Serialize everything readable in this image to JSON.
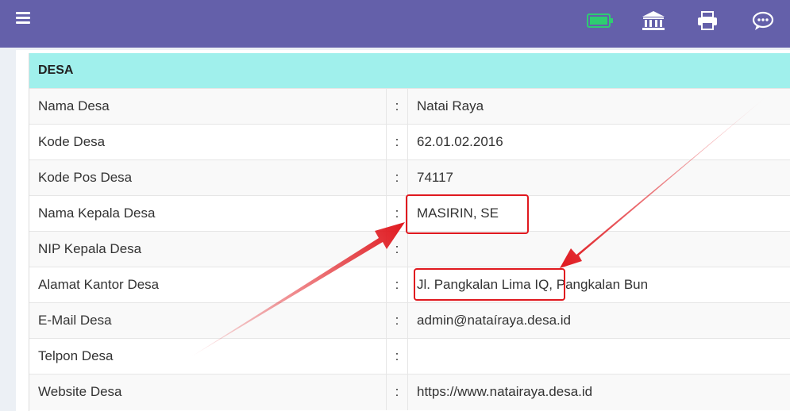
{
  "panel": {
    "title": "DESA"
  },
  "rows": [
    {
      "label": "Nama Desa",
      "sep": ":",
      "value": "Natai Raya"
    },
    {
      "label": "Kode Desa",
      "sep": ":",
      "value": "62.01.02.2016"
    },
    {
      "label": "Kode Pos Desa",
      "sep": ":",
      "value": "74117"
    },
    {
      "label": "Nama Kepala Desa",
      "sep": ":",
      "value": "MASIRIN, SE"
    },
    {
      "label": "NIP Kepala Desa",
      "sep": ":",
      "value": ""
    },
    {
      "label": "Alamat Kantor Desa",
      "sep": ":",
      "value": "Jl. Pangkalan Lima IQ, Pangkalan Bun"
    },
    {
      "label": "E-Mail Desa",
      "sep": ":",
      "value": "admin@nataíraya.desa.id"
    },
    {
      "label": "Telpon Desa",
      "sep": ":",
      "value": ""
    },
    {
      "label": "Website Desa",
      "sep": ":",
      "value": "https://www.natairaya.desa.id"
    }
  ],
  "toolbar": {
    "icons": [
      "battery-icon",
      "bank-icon",
      "printer-icon",
      "chat-icon"
    ]
  },
  "colors": {
    "topbar": "#6460aa",
    "panel_header": "#a0f0ec",
    "highlight": "#e0191f"
  }
}
